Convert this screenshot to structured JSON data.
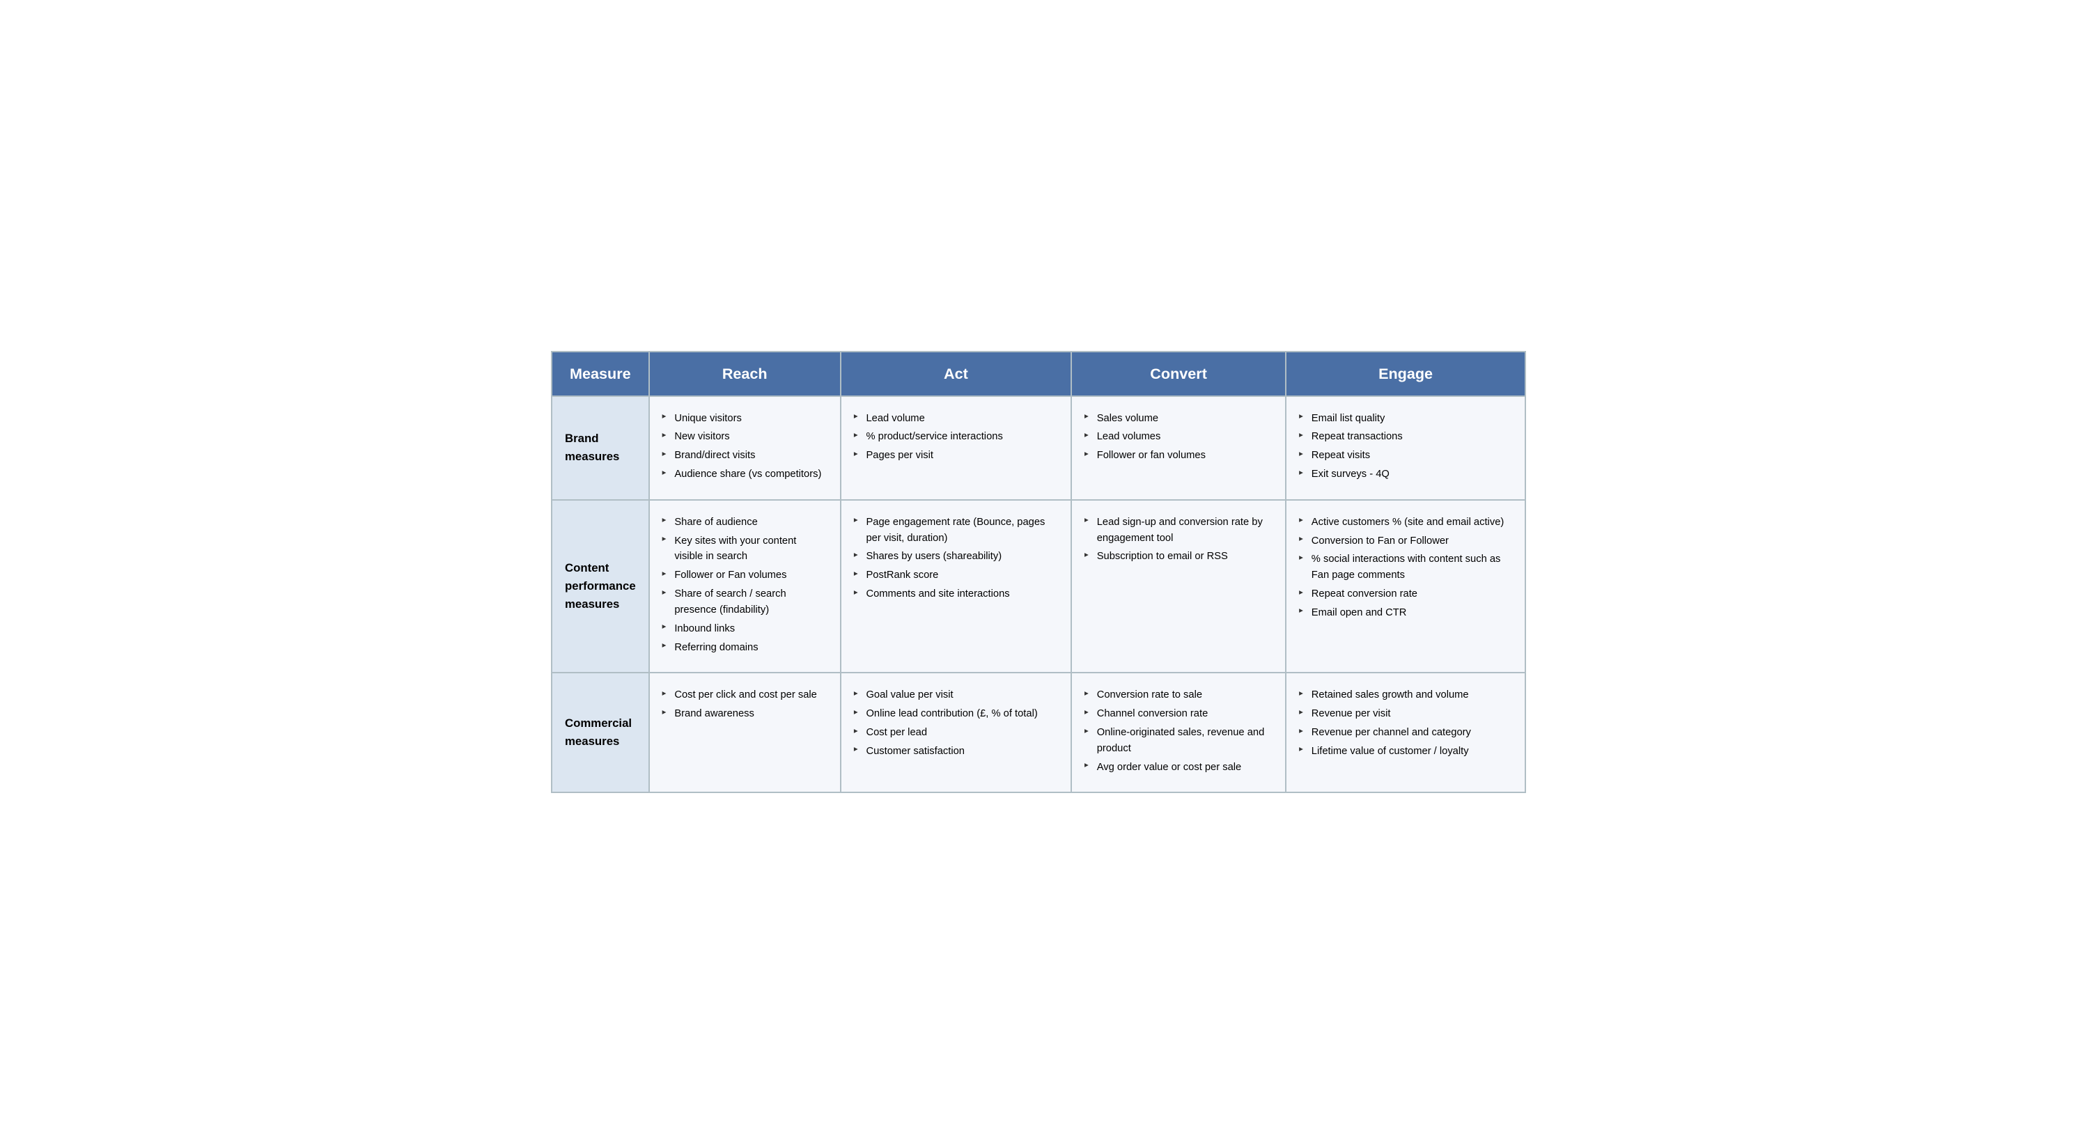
{
  "header": {
    "col1": "Measure",
    "col2": "Reach",
    "col3": "Act",
    "col4": "Convert",
    "col5": "Engage"
  },
  "rows": [
    {
      "measure": "Brand measures",
      "reach": [
        "Unique visitors",
        "New visitors",
        "Brand/direct visits",
        "Audience share (vs competitors)"
      ],
      "act": [
        "Lead volume",
        "% product/service interactions",
        "Pages per visit"
      ],
      "convert": [
        "Sales volume",
        "Lead volumes",
        "Follower or fan volumes"
      ],
      "engage": [
        "Email list quality",
        "Repeat transactions",
        "Repeat visits",
        "Exit surveys - 4Q"
      ]
    },
    {
      "measure": "Content performance measures",
      "reach": [
        "Share of audience",
        "Key sites with your content visible in search",
        "Follower or Fan volumes",
        "Share of search / search presence (findability)",
        "Inbound links",
        "Referring domains"
      ],
      "act": [
        "Page engagement rate (Bounce, pages per visit, duration)",
        "Shares by users (shareability)",
        "PostRank score",
        "Comments and site interactions"
      ],
      "convert": [
        "Lead sign-up and conversion rate by engagement tool",
        "Subscription to email or RSS"
      ],
      "engage": [
        "Active customers % (site and email active)",
        "Conversion to Fan or Follower",
        "% social interactions with content such as Fan page comments",
        "Repeat conversion rate",
        "Email open and CTR"
      ]
    },
    {
      "measure": "Commercial measures",
      "reach": [
        "Cost per click and cost per sale",
        "Brand awareness"
      ],
      "act": [
        "Goal value per visit",
        "Online lead contribution (£, % of total)",
        "Cost per lead",
        "Customer satisfaction"
      ],
      "convert": [
        "Conversion rate to sale",
        "Channel conversion rate",
        "Online-originated sales, revenue and product",
        "Avg order value or cost per sale"
      ],
      "engage": [
        "Retained sales growth and volume",
        "Revenue per visit",
        "Revenue per channel and category",
        "Lifetime value of customer / loyalty"
      ]
    }
  ]
}
